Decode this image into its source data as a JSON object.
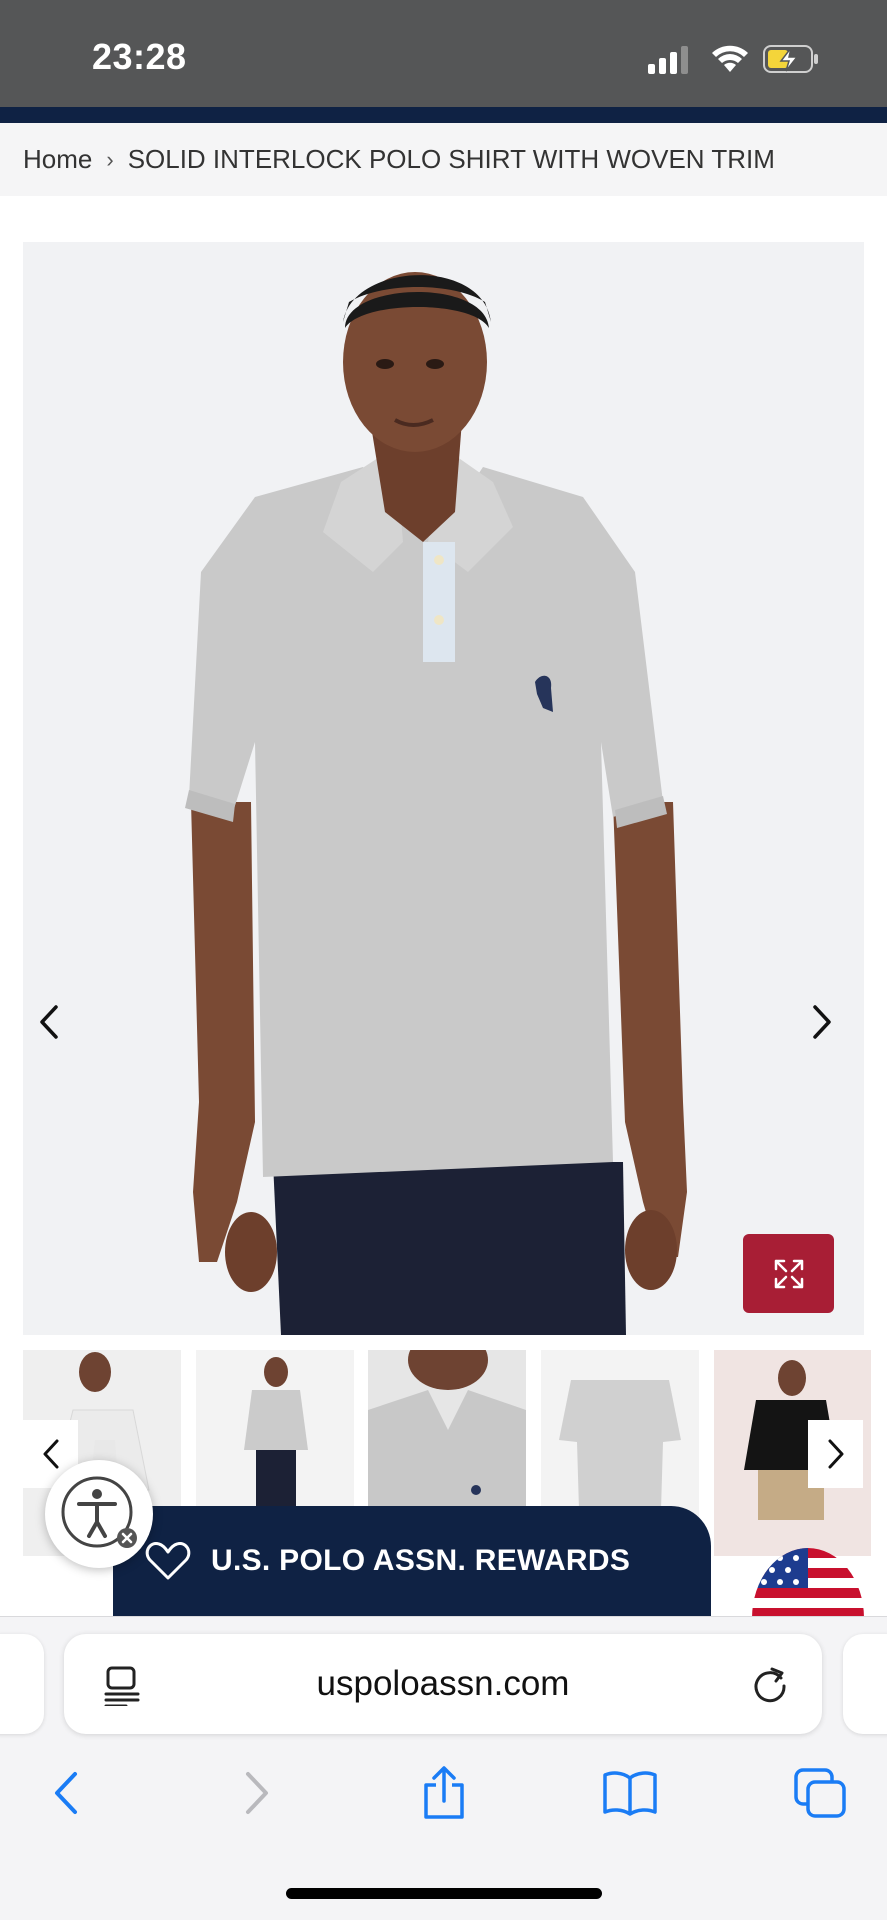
{
  "status_bar": {
    "time": "23:28"
  },
  "breadcrumb": {
    "home": "Home",
    "separator": "›",
    "current": "SOLID INTERLOCK POLO SHIRT WITH WOVEN TRIM"
  },
  "gallery": {
    "image_count_thumbnails": 5,
    "icons": {
      "prev": "chevron-left-icon",
      "next": "chevron-right-icon",
      "expand": "expand-icon"
    },
    "expand_button_color": "#a81e35"
  },
  "accessibility": {
    "icon": "accessibility-icon"
  },
  "rewards": {
    "label": "U.S. POLO ASSN. REWARDS",
    "icon": "heart-icon",
    "background": "#0f2244"
  },
  "browser": {
    "url": "uspoloassn.com",
    "icons": [
      "reader-icon",
      "reload-icon",
      "back-icon",
      "forward-icon",
      "share-icon",
      "bookmarks-icon",
      "tabs-icon"
    ]
  },
  "colors": {
    "accent_blue": "#1a7cf5",
    "brand_navy": "#0f2244",
    "brand_red": "#a81e35"
  }
}
